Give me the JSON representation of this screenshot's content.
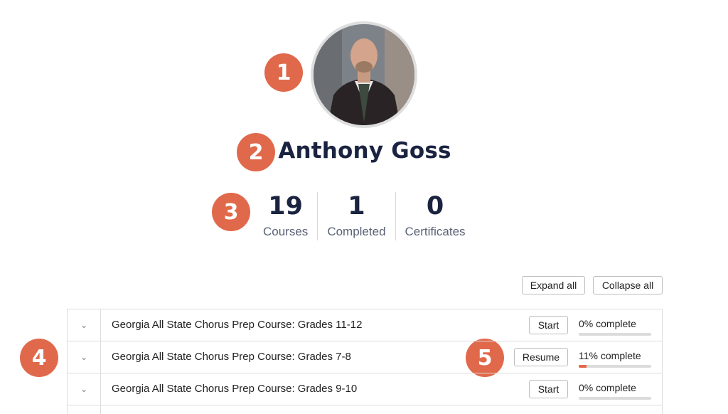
{
  "badges": [
    "1",
    "2",
    "3",
    "4",
    "5"
  ],
  "profile": {
    "name": "Anthony Goss",
    "stats": [
      {
        "value": "19",
        "label": "Courses"
      },
      {
        "value": "1",
        "label": "Completed"
      },
      {
        "value": "0",
        "label": "Certificates"
      }
    ]
  },
  "toolbar": {
    "expand_label": "Expand all",
    "collapse_label": "Collapse all"
  },
  "courses": [
    {
      "title": "Georgia All State Chorus Prep Course: Grades 11-12",
      "action": "Start",
      "progress_text": "0% complete",
      "progress": 0
    },
    {
      "title": "Georgia All State Chorus Prep Course: Grades 7-8",
      "action": "Resume",
      "progress_text": "11% complete",
      "progress": 0.11
    },
    {
      "title": "Georgia All State Chorus Prep Course: Grades 9-10",
      "action": "Start",
      "progress_text": "0% complete",
      "progress": 0
    }
  ],
  "colors": {
    "accent": "#e0694b",
    "heading": "#1a2340"
  },
  "icons": {
    "expand_row": "chevron-down-icon"
  }
}
